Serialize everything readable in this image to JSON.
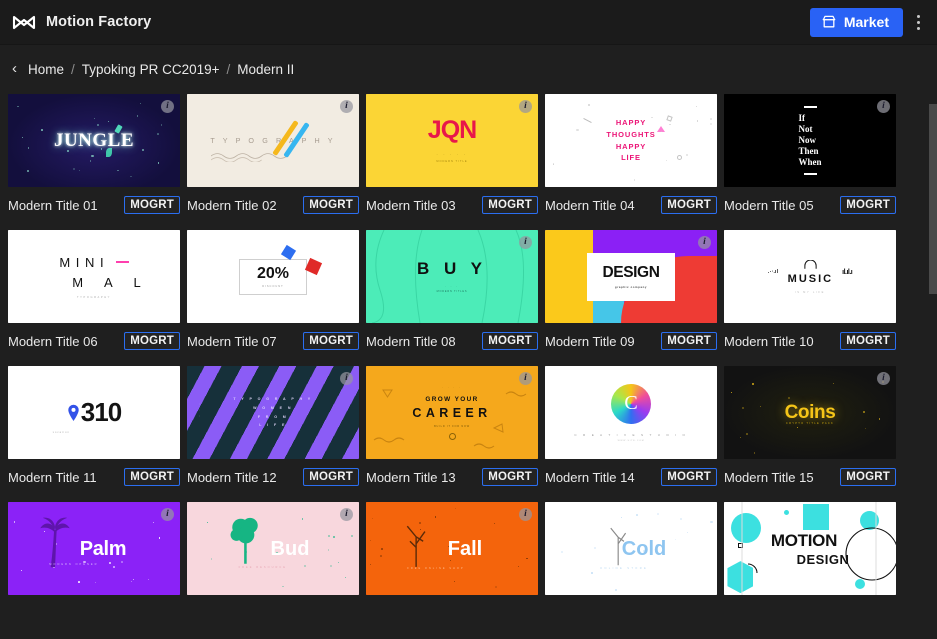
{
  "window": {
    "background": "#1f1f1f",
    "topbar_background": "#1b1b1b"
  },
  "topbar": {
    "logo_icon": "motion-factory-logo-icon",
    "brand_title": "Motion Factory",
    "market_label": "Market",
    "market_icon": "storefront-icon",
    "market_color": "#2962f5",
    "overflow_icon": "kebab-menu-icon"
  },
  "breadcrumb": {
    "back_icon": "chevron-left-icon",
    "back_glyph": "‹",
    "items": [
      {
        "label": "Home",
        "current": false
      },
      {
        "label": "Typoking PR CC2019+",
        "current": false
      },
      {
        "label": "Modern II",
        "current": true
      }
    ],
    "separator": "/"
  },
  "grid": {
    "badge_glyph": "i",
    "tag_label": "MOGRT",
    "cards": [
      {
        "title": "Modern Title 01",
        "tag": "MOGRT",
        "info": true,
        "art": "jungle",
        "bg": "#130f3d",
        "accent": "#ffffff"
      },
      {
        "title": "Modern Title 02",
        "tag": "MOGRT",
        "info": true,
        "art": "typography",
        "bg": "#f2ece2",
        "accent": "#9d9286"
      },
      {
        "title": "Modern Title 03",
        "tag": "MOGRT",
        "info": true,
        "art": "jqn",
        "bg": "#fbd535",
        "accent": "#e8174a"
      },
      {
        "title": "Modern Title 04",
        "tag": "MOGRT",
        "info": false,
        "art": "happy",
        "bg": "#ffffff",
        "accent": "#ec1577"
      },
      {
        "title": "Modern Title 05",
        "tag": "MOGRT",
        "info": true,
        "art": "ifnotnow",
        "bg": "#000000",
        "accent": "#ffffff"
      },
      {
        "title": "Modern Title 06",
        "tag": "MOGRT",
        "info": false,
        "art": "minimal",
        "bg": "#ffffff",
        "accent": "#111111"
      },
      {
        "title": "Modern Title 07",
        "tag": "MOGRT",
        "info": false,
        "art": "twentypct",
        "bg": "#ffffff",
        "accent": "#111111"
      },
      {
        "title": "Modern Title 08",
        "tag": "MOGRT",
        "info": true,
        "art": "buy",
        "bg": "#4cecb8",
        "accent": "#101010"
      },
      {
        "title": "Modern Title 09",
        "tag": "MOGRT",
        "info": true,
        "art": "design",
        "bg": "#8b20f5",
        "accent": "#111111"
      },
      {
        "title": "Modern Title 10",
        "tag": "MOGRT",
        "info": false,
        "art": "music",
        "bg": "#ffffff",
        "accent": "#111111"
      },
      {
        "title": "Modern Title 11",
        "tag": "MOGRT",
        "info": false,
        "art": "threeten",
        "bg": "#ffffff",
        "accent": "#1a1a1a"
      },
      {
        "title": "Modern Title 12",
        "tag": "MOGRT",
        "info": true,
        "art": "stripes",
        "bg": "#16303a",
        "accent": "#8b5cf6"
      },
      {
        "title": "Modern Title 13",
        "tag": "MOGRT",
        "info": true,
        "art": "career",
        "bg": "#f5a81c",
        "accent": "#111111"
      },
      {
        "title": "Modern Title 14",
        "tag": "MOGRT",
        "info": false,
        "art": "creative",
        "bg": "#ffffff",
        "accent": "#ffffff"
      },
      {
        "title": "Modern Title 15",
        "tag": "MOGRT",
        "info": true,
        "art": "coins",
        "bg": "#121212",
        "accent": "#f5c518"
      },
      {
        "title": "",
        "tag": "",
        "info": true,
        "art": "palm",
        "bg": "#8b22f7",
        "accent": "#ffffff"
      },
      {
        "title": "",
        "tag": "",
        "info": true,
        "art": "bud",
        "bg": "#f8d7dd",
        "accent": "#ffffff"
      },
      {
        "title": "",
        "tag": "",
        "info": true,
        "art": "fall",
        "bg": "#f4640c",
        "accent": "#ffffff"
      },
      {
        "title": "",
        "tag": "",
        "info": false,
        "art": "cold",
        "bg": "#ffffff",
        "accent": "#8ec5f0"
      },
      {
        "title": "",
        "tag": "",
        "info": false,
        "art": "motiondesign",
        "bg": "#ffffff",
        "accent": "#3ce0e0"
      }
    ],
    "art_text": {
      "jungle": {
        "main": "JUNGLE",
        "sub": ""
      },
      "typography": {
        "main": "T Y P O G R A P H Y",
        "sub": ""
      },
      "jqn": {
        "main": "JQN",
        "sub": "MODERN TITLE"
      },
      "happy": {
        "main": "HAPPY THOUGHTS HAPPY LIFE",
        "sub": ""
      },
      "ifnotnow": {
        "main": "If Not Now Then When",
        "sub": ""
      },
      "minimal": {
        "main": "MINIMAL",
        "sub": "TYPOGRAPHY"
      },
      "twentypct": {
        "main": "20%",
        "sub": "DISCOUNT"
      },
      "buy": {
        "main": "B U Y",
        "sub": "MODERN TITLES"
      },
      "design": {
        "main": "DESIGN",
        "sub": "graphic company"
      },
      "music": {
        "main": "MUSIC",
        "sub": "IS MY LIFE"
      },
      "threeten": {
        "main": "310",
        "sub": "Location"
      },
      "stripes": {
        "main": "TYPOGRAPHY WOMEN FROM LIFE",
        "sub": ""
      },
      "career": {
        "main": "CAREER",
        "top": "GROW YOUR",
        "sub": "BUILD IT FOR NOW"
      },
      "creative": {
        "main": "C",
        "sub": "C R E A T I V E   S T U D I O"
      },
      "coins": {
        "main": "Coins",
        "sub": "CRYPTO TITLE PACK"
      },
      "palm": {
        "main": "Palm",
        "sub": "MODERN OPENER"
      },
      "bud": {
        "main": "Bud",
        "sub": "FREE RESOURCE"
      },
      "fall": {
        "main": "Fall",
        "sub": "FREE ONLINE SHOP"
      },
      "cold": {
        "main": "Cold",
        "sub": "ONLINE STORE"
      },
      "motiondesign": {
        "main": "MOTION",
        "sub": "DESIGN"
      }
    }
  },
  "scrollbar": {
    "thumb_color": "#4a4a4a",
    "orientation": "vertical"
  }
}
